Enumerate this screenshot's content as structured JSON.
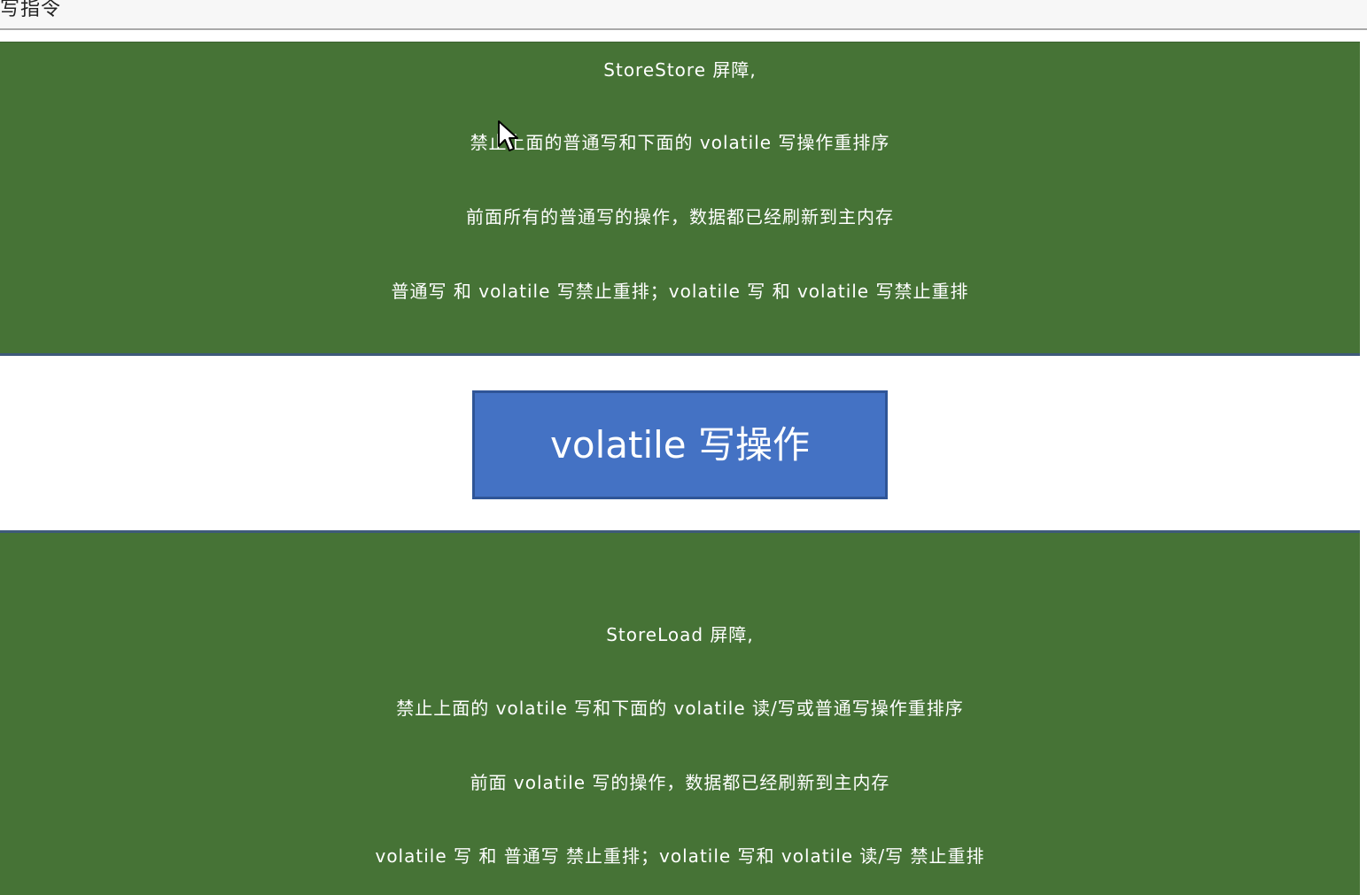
{
  "header": {
    "caption": "写指令"
  },
  "storestore": {
    "lines": [
      "StoreStore 屏障,",
      "禁止上面的普通写和下面的 volatile 写操作重排序",
      "前面所有的普通写的操作，数据都已经刷新到主内存",
      "普通写  和  volatile 写禁止重排；volatile 写  和  volatile 写禁止重排"
    ]
  },
  "action": {
    "label": "volatile 写操作"
  },
  "storeload": {
    "lines": [
      "StoreLoad 屏障,",
      "禁止上面的 volatile 写和下面的 volatile 读/写或普通写操作重排序",
      "前面 volatile 写的操作，数据都已经刷新到主内存",
      "volatile 写  和  普通写  禁止重排；volatile 写和  volatile 读/写  禁止重排"
    ]
  },
  "colors": {
    "panel_green": "#467336",
    "action_blue": "#4472c4",
    "text": "#ffffff"
  }
}
